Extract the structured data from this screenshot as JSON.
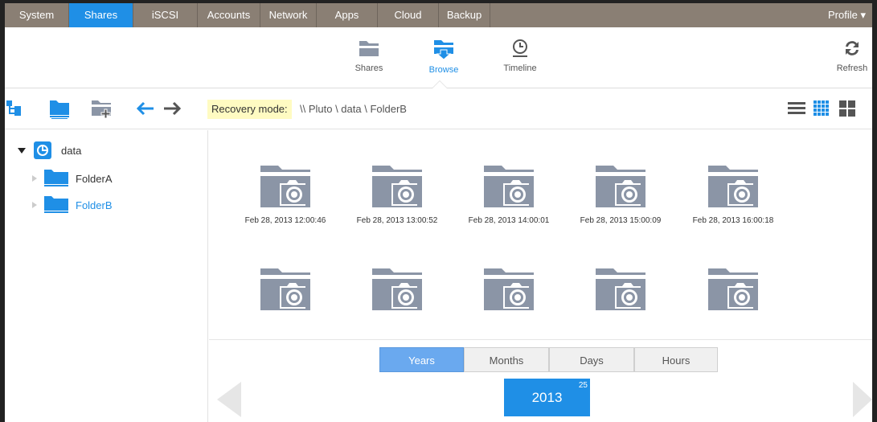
{
  "topnav": {
    "tabs": [
      {
        "label": "System",
        "active": false
      },
      {
        "label": "Shares",
        "active": true
      },
      {
        "label": "iSCSI",
        "active": false
      },
      {
        "label": "Accounts",
        "active": false
      },
      {
        "label": "Network",
        "active": false
      },
      {
        "label": "Apps",
        "active": false
      },
      {
        "label": "Cloud",
        "active": false
      },
      {
        "label": "Backup",
        "active": false
      }
    ],
    "profile": "Profile ▾"
  },
  "toolbar": {
    "shares": "Shares",
    "browse": "Browse",
    "timeline": "Timeline",
    "refresh": "Refresh"
  },
  "pathbar": {
    "recovery_label": "Recovery mode:",
    "path": "\\\\ Pluto \\ data \\ FolderB"
  },
  "tree": {
    "root": "data",
    "children": [
      "FolderA",
      "FolderB"
    ],
    "selected": "FolderB"
  },
  "snapshots": [
    "Feb 28, 2013 12:00:46",
    "Feb 28, 2013 13:00:52",
    "Feb 28, 2013 14:00:01",
    "Feb 28, 2013 15:00:09",
    "Feb 28, 2013 16:00:18"
  ],
  "timesel": {
    "segments": [
      "Years",
      "Months",
      "Days",
      "Hours"
    ],
    "active": "Years",
    "year": "2013",
    "count": "25"
  },
  "colors": {
    "accent": "#1f8fe6",
    "nav_bg": "#8a7f74",
    "folder": "#8b95a6"
  }
}
